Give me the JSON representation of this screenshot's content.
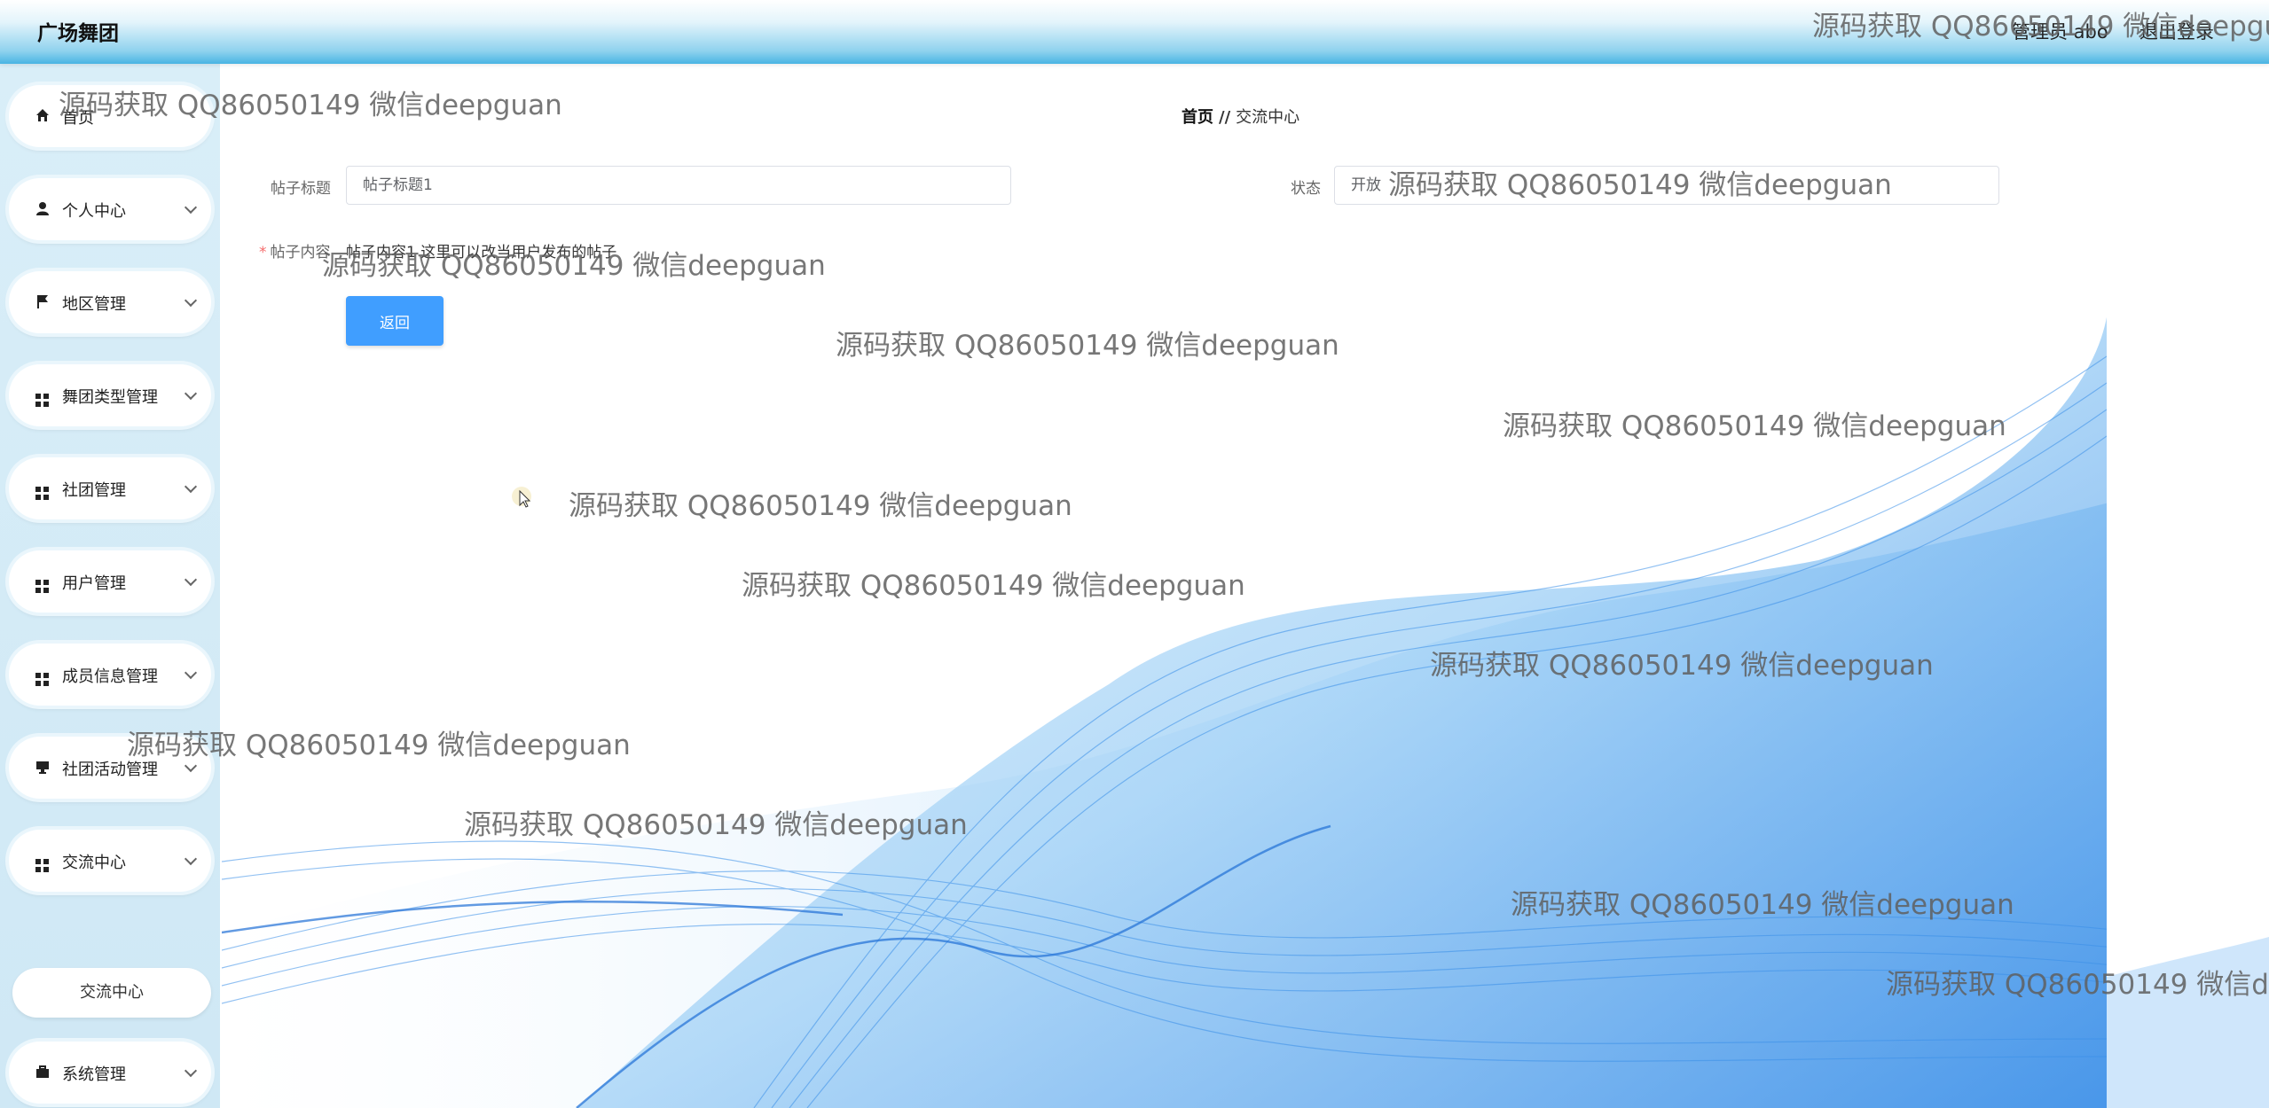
{
  "header": {
    "app_title": "广场舞团",
    "user_info": "管理员 abo",
    "logout": "退出登录"
  },
  "sidebar": {
    "items": [
      {
        "label": "首页",
        "icon": "home-icon",
        "has_arrow": false
      },
      {
        "label": "个人中心",
        "icon": "user-icon",
        "has_arrow": true
      },
      {
        "label": "地区管理",
        "icon": "flag-icon",
        "has_arrow": true
      },
      {
        "label": "舞团类型管理",
        "icon": "grid-icon",
        "has_arrow": true
      },
      {
        "label": "社团管理",
        "icon": "grid-icon",
        "has_arrow": true
      },
      {
        "label": "用户管理",
        "icon": "grid-icon",
        "has_arrow": true
      },
      {
        "label": "成员信息管理",
        "icon": "grid-icon",
        "has_arrow": true
      },
      {
        "label": "社团活动管理",
        "icon": "monitor-icon",
        "has_arrow": true
      },
      {
        "label": "交流中心",
        "icon": "grid-icon",
        "has_arrow": true,
        "expanded": true
      },
      {
        "label": "系统管理",
        "icon": "briefcase-icon",
        "has_arrow": true
      }
    ],
    "sub_item": "交流中心"
  },
  "breadcrumb": {
    "home": "首页",
    "separator": "//",
    "current": "交流中心"
  },
  "form": {
    "title_label": "帖子标题",
    "title_value": "帖子标题1",
    "status_label": "状态",
    "status_value": "开放",
    "content_required": "*",
    "content_label": "帖子内容",
    "content_value": "帖子内容1 这里可以改当用户发布的帖子",
    "back_button": "返回"
  },
  "watermark_text": "源码获取 QQ86050149 微信deepguan",
  "colors": {
    "primary_button": "#409eff",
    "topbar_accent": "#49b4e3",
    "sidebar_bg": "#d9eef8",
    "wave_blue": "#3a8fe8"
  }
}
